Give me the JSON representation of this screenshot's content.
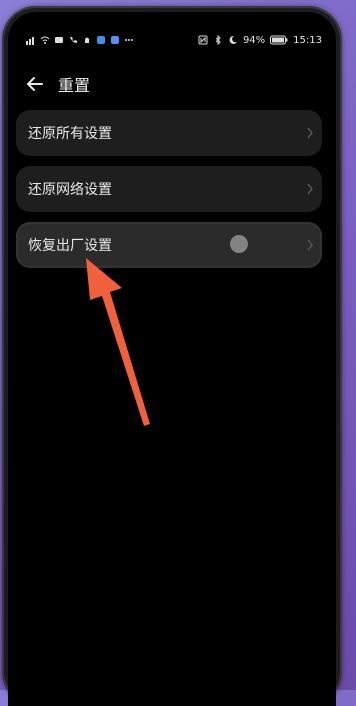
{
  "status": {
    "battery": "94%",
    "time": "15:13",
    "icons": [
      "signal-icon",
      "wifi-icon",
      "message-icon",
      "call-icon",
      "notification-icon",
      "app-icon",
      "app-icon-2",
      "more-icon",
      "nfc-icon",
      "bluetooth-icon",
      "moon-icon",
      "battery-icon"
    ]
  },
  "header": {
    "title": "重置"
  },
  "menu": {
    "items": [
      {
        "label": "还原所有设置"
      },
      {
        "label": "还原网络设置"
      },
      {
        "label": "恢复出厂设置"
      }
    ]
  },
  "colors": {
    "accent_arrow": "#f0603a",
    "background": "#000000",
    "row_bg": "#1e1e1e"
  }
}
